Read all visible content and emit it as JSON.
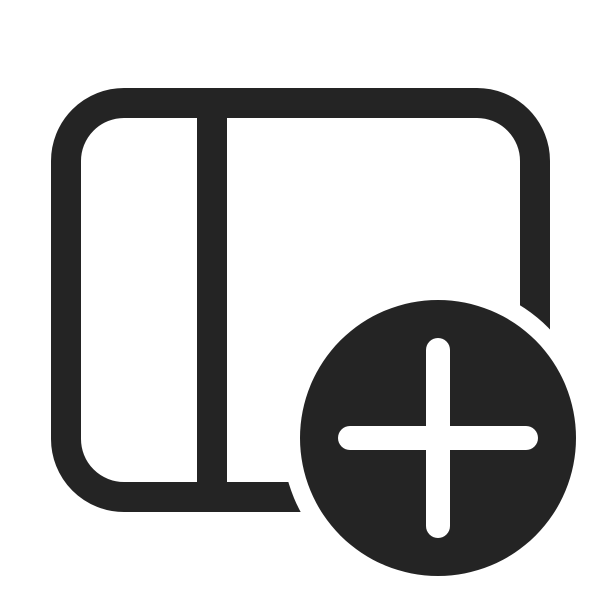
{
  "icon": {
    "name": "sidebar-panel-add-icon",
    "parts": [
      "panel-frame-icon",
      "sidebar-divider-icon",
      "add-circle-icon",
      "plus-icon"
    ]
  },
  "colors": {
    "glyph": "#242424",
    "background": "#ffffff",
    "plus": "#ffffff"
  }
}
